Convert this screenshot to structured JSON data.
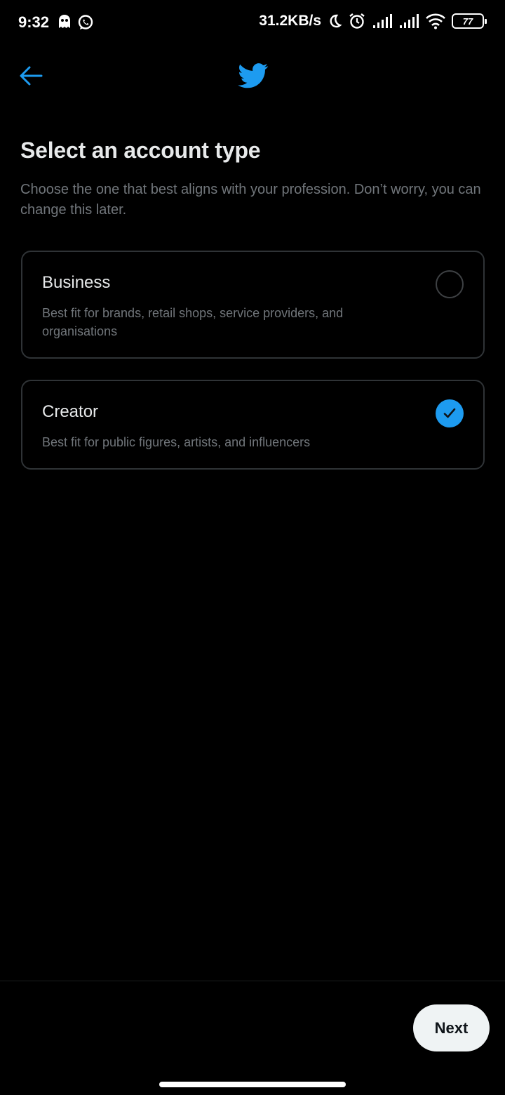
{
  "status_bar": {
    "time": "9:32",
    "left_icons": [
      "ghost-icon",
      "whatsapp-icon"
    ],
    "network_speed": "31.2KB/s",
    "right_icons": [
      "moon-icon",
      "alarm-icon",
      "signal-icon",
      "signal-icon",
      "wifi-icon"
    ],
    "battery_level": "77"
  },
  "nav": {
    "back_icon": "arrow-left-icon",
    "logo_icon": "twitter-bird-icon"
  },
  "page": {
    "title": "Select an account type",
    "subtitle": "Choose the one that best aligns with your profession. Don’t worry, you can change this later."
  },
  "options": [
    {
      "label": "Business",
      "description": "Best fit for brands, retail shops, service providers, and organisations",
      "selected": false
    },
    {
      "label": "Creator",
      "description": "Best fit for public figures, artists, and influencers",
      "selected": true
    }
  ],
  "footer": {
    "next_label": "Next"
  },
  "colors": {
    "accent": "#1d9bf0",
    "background": "#000000",
    "primary_text": "#e7e9ea",
    "secondary_text": "#71767b",
    "border": "#2f3336"
  }
}
